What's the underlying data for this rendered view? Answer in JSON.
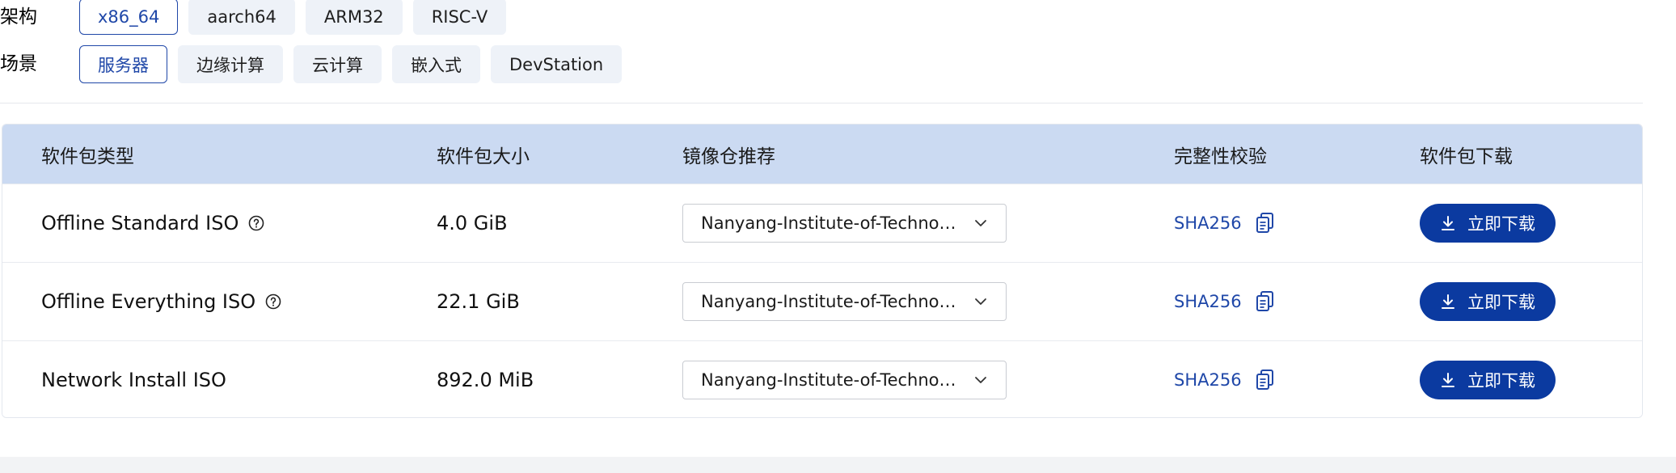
{
  "filters": {
    "arch": {
      "label": "架构",
      "options": [
        "x86_64",
        "aarch64",
        "ARM32",
        "RISC-V"
      ],
      "selected": "x86_64"
    },
    "scene": {
      "label": "场景",
      "options": [
        "服务器",
        "边缘计算",
        "云计算",
        "嵌入式",
        "DevStation"
      ],
      "selected": "服务器"
    }
  },
  "table": {
    "headers": [
      "软件包类型",
      "软件包大小",
      "镜像仓推荐",
      "完整性校验",
      "软件包下载"
    ],
    "rows": [
      {
        "type": "Offline Standard ISO",
        "has_help": true,
        "size": "4.0 GiB",
        "mirror": "Nanyang-Institute-of-Technol...",
        "checksum": "SHA256",
        "download": "立即下载"
      },
      {
        "type": "Offline Everything ISO",
        "has_help": true,
        "size": "22.1 GiB",
        "mirror": "Nanyang-Institute-of-Technol...",
        "checksum": "SHA256",
        "download": "立即下载"
      },
      {
        "type": "Network Install ISO",
        "has_help": false,
        "size": "892.0 MiB",
        "mirror": "Nanyang-Institute-of-Technol...",
        "checksum": "SHA256",
        "download": "立即下载"
      }
    ]
  },
  "colors": {
    "accent": "#1f47a8",
    "button": "#0b3aa0",
    "header_bg": "#cbdaf2",
    "chip_bg": "#eef2f8"
  },
  "icons": {
    "help": "question-circle-icon",
    "chevron": "chevron-down-icon",
    "copy": "copy-icon",
    "download": "download-icon"
  }
}
